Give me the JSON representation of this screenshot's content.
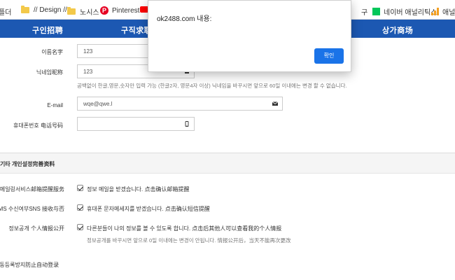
{
  "bookmarks": {
    "partial_label": "플더",
    "items": [
      {
        "label": "// Design //",
        "icon": "folder-icon"
      },
      {
        "label": "노시스",
        "icon": "folder-icon"
      },
      {
        "label": "Pinterest",
        "icon": "pinterest-icon"
      },
      {
        "label": "",
        "icon": "youtube-icon"
      },
      {
        "label": "구",
        "icon": ""
      },
      {
        "label": "네이버 애널리틱스",
        "icon": "naver-icon"
      },
      {
        "label": "애널",
        "icon": "analytics-icon"
      }
    ]
  },
  "nav": {
    "items": [
      "구인招聘",
      "구직求职",
      "상가商场"
    ]
  },
  "form": {
    "name_label": "이름名字",
    "name_value": "123",
    "nickname_label": "닉네임昵称",
    "nickname_value": "123",
    "nickname_help": "공백없이 한글,영문,숫자만 입력 가능 (한글2자, 영문4자 이상) 닉네임을 바꾸시면 앞으로 60일 이내에는 변경 할 수 없습니다.",
    "email_label": "E-mail",
    "email_value": "wqe@qwe.l",
    "phone_label": "휴대폰번호 电话号码",
    "phone_value": ""
  },
  "section": {
    "title": "기타 개인설정完善资料"
  },
  "settings": [
    {
      "label": "메일링서비스邮箱提醒服务",
      "text": "정보 메일을 받겠습니다. 点击确认邮箱提醒",
      "checked": true
    },
    {
      "label": "SMS 수신여부SNS 接收与否",
      "text": "휴대폰 문자메세지를 받겠습니다. 点击确认短信提醒",
      "checked": true
    },
    {
      "label": "정보공개 个人情报公开",
      "text": "다른분들이 나의 정보를 볼 수 있도록 합니다. 点击后其他人可以查看我的个人情报",
      "checked": true
    }
  ],
  "settings_help": "정보공개를 바꾸시면 앞으로 0일 이내에는 변경이 안됩니다. 情报公开后，当天不能再次更改",
  "captcha_label": "자동등록방지防止自动登录",
  "dialog": {
    "title": "ok2488.com 내용:",
    "ok_label": "확인",
    "ok_color": "#1a73e8"
  },
  "colors": {
    "nav_bg": "#1c58b2"
  }
}
